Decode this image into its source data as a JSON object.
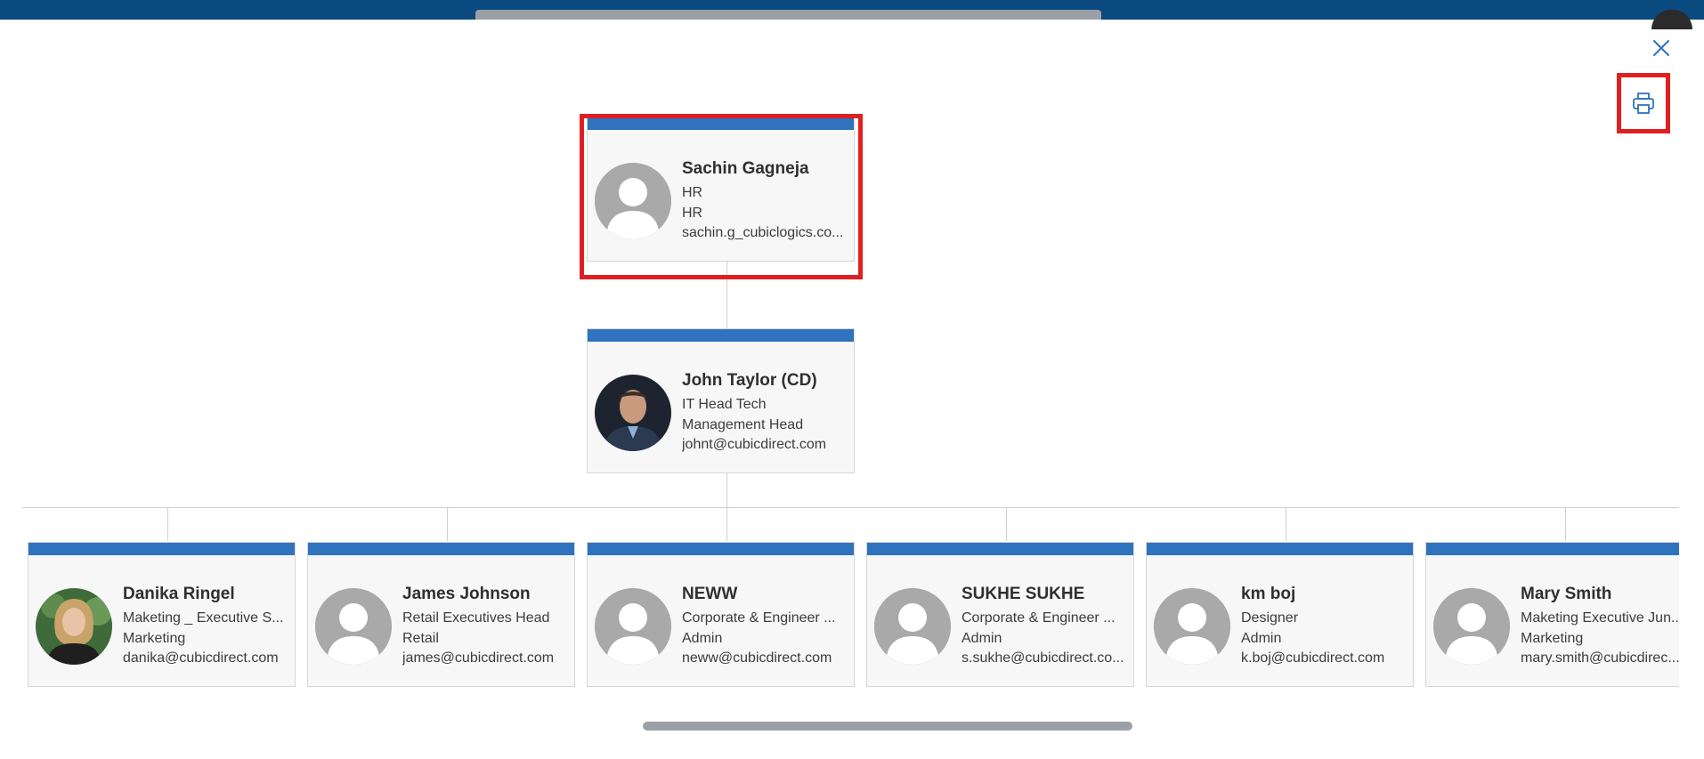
{
  "colors": {
    "header": "#0a4a7f",
    "card_bar": "#2f72be",
    "highlight": "#e02020",
    "accent": "#2f72be"
  },
  "toolbar": {
    "close_icon": "close-icon",
    "print_icon": "printer-icon"
  },
  "root": {
    "name": "Sachin Gagneja",
    "title": "HR",
    "department": "HR",
    "email": "sachin.g_cubiclogics.co..."
  },
  "manager": {
    "name": "John Taylor (CD)",
    "title": "IT Head Tech",
    "department": "Management Head",
    "email": "johnt@cubicdirect.com"
  },
  "reports": [
    {
      "name": "Danika Ringel",
      "title": "Maketing _ Executive S...",
      "department": "Marketing",
      "email": "danika@cubicdirect.com",
      "photo": "woman-portrait"
    },
    {
      "name": "James Johnson",
      "title": "Retail Executives Head",
      "department": "Retail",
      "email": "james@cubicdirect.com",
      "photo": "placeholder"
    },
    {
      "name": "NEWW",
      "title": "Corporate & Engineer ...",
      "department": "Admin",
      "email": "neww@cubicdirect.com",
      "photo": "placeholder"
    },
    {
      "name": "SUKHE SUKHE",
      "title": "Corporate & Engineer ...",
      "department": "Admin",
      "email": "s.sukhe@cubicdirect.co...",
      "photo": "placeholder"
    },
    {
      "name": "km boj",
      "title": "Designer",
      "department": "Admin",
      "email": "k.boj@cubicdirect.com",
      "photo": "placeholder"
    },
    {
      "name": "Mary Smith",
      "title": "Maketing Executive Jun...",
      "department": "Marketing",
      "email": "mary.smith@cubicdirec...",
      "photo": "placeholder"
    }
  ]
}
